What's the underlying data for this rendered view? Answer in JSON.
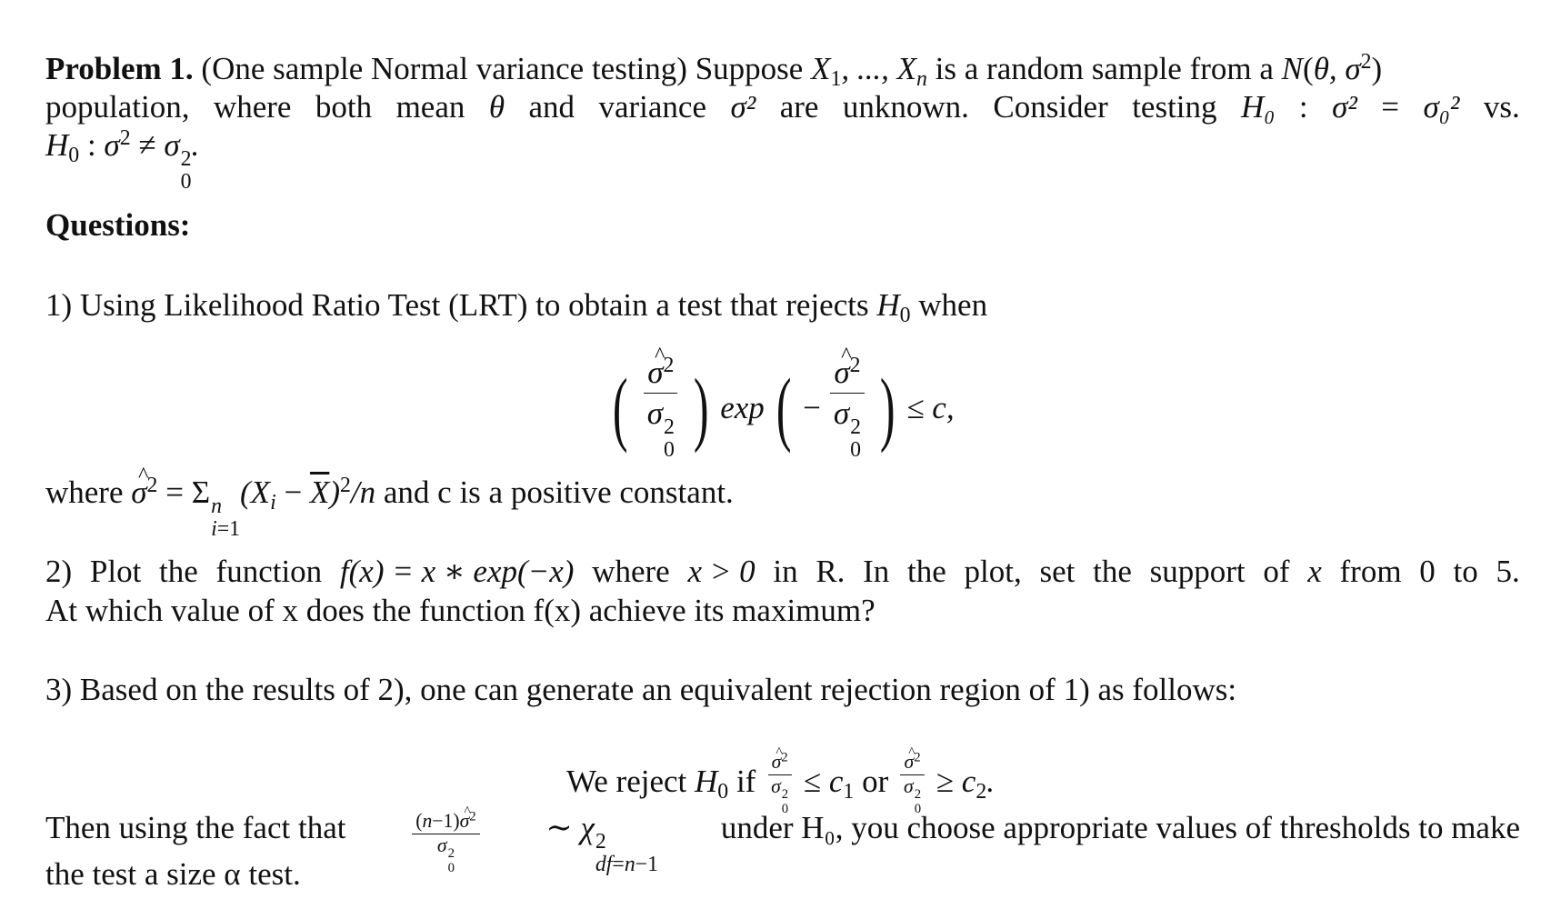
{
  "problem": {
    "label": "Problem 1.",
    "intro": "(One sample Normal variance testing) Suppose X₁, ..., Xₙ is a random sample from a N(θ, σ²)",
    "intro_parts": {
      "a": "(One sample Normal variance testing) Suppose ",
      "b": " is a random sample from a "
    },
    "line2_words": [
      "population,",
      "where",
      "both",
      "mean",
      "θ",
      "and",
      "variance",
      "σ²",
      "are",
      "unknown.",
      "Consider",
      "testing",
      "H₀",
      ":",
      "σ²",
      "=",
      "σ₀²",
      "vs."
    ],
    "line3": "H₀ : σ² ≠ σ₀²."
  },
  "questions_heading": "Questions:",
  "q1": {
    "text": "1) Using Likelihood Ratio Test (LRT) to obtain a test that rejects H₀ when",
    "text_before_h0": "1) Using Likelihood Ratio Test (LRT) to obtain a test that rejects ",
    "text_after_h0": " when",
    "display_formula": "(σ̂²/σ₀²) exp(−σ̂²/σ₀²) ≤ c,",
    "exp_label": "exp",
    "leq_c": "≤ c,",
    "where_text": "where σ̂² = Σⁿᵢ₌₁(Xᵢ − X̄)²/n and c is a positive constant.",
    "where_tail": " and c is a positive constant."
  },
  "q2": {
    "line1_words": [
      "2)",
      "Plot",
      "the",
      "function",
      "f(x) = x ∗ exp(−x)",
      "where",
      "x > 0",
      "in",
      "R.",
      "In",
      "the",
      "plot,",
      "set",
      "the",
      "support",
      "of",
      "x",
      "from",
      "0",
      "to",
      "5."
    ],
    "line2": "At which value of x does the function f(x) achieve its maximum?"
  },
  "q3": {
    "text": "3) Based on the results of 2), one can generate an equivalent rejection region of 1) as follows:",
    "reject_rule": "We reject H₀ if σ̂²/σ₀² ≤ c₁ or σ̂²/σ₀² ≥ c₂.",
    "then_text": "Then using the fact that (n−1)σ̂²/σ₀² ∼ χ²_{df=n−1} under H₀, you choose appropriate values of thresholds to make",
    "then_before": "Then using the fact that",
    "then_after": "under H₀, you choose appropriate values of thresholds to make",
    "last_line": "the test a size α test."
  }
}
